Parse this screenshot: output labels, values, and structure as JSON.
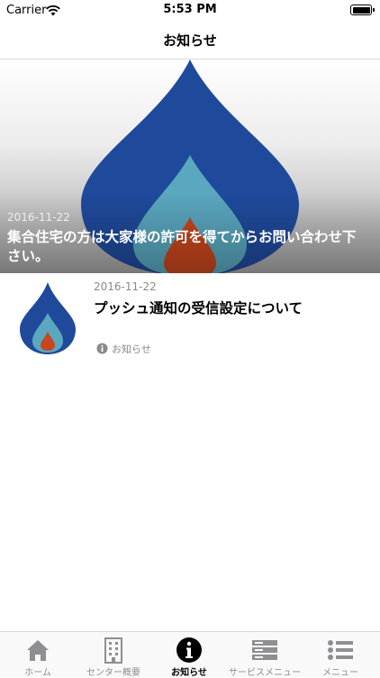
{
  "status_bar": {
    "carrier": "Carrier",
    "time": "5:53 PM"
  },
  "nav": {
    "title": "お知らせ"
  },
  "featured": {
    "date": "2016-11-22",
    "title": "集合住宅の方は大家様の許可を得てからお問い合わせ下さい。"
  },
  "items": [
    {
      "date": "2016-11-22",
      "title": "プッシュ通知の受信設定について",
      "category": "お知らせ",
      "category_icon": "info-icon"
    }
  ],
  "tabs": [
    {
      "label": "ホーム",
      "icon": "home-icon"
    },
    {
      "label": "センター概要",
      "icon": "building-icon"
    },
    {
      "label": "お知らせ",
      "icon": "info-icon",
      "active": true
    },
    {
      "label": "サービスメニュー",
      "icon": "service-menu-icon"
    },
    {
      "label": "メニュー",
      "icon": "list-menu-icon"
    }
  ],
  "colors": {
    "flame_outer": "#1f4a9c",
    "flame_middle": "#5aa7bf",
    "flame_inner": "#c8461e",
    "active_tab": "#000000",
    "inactive_tab": "#8e8e93"
  }
}
